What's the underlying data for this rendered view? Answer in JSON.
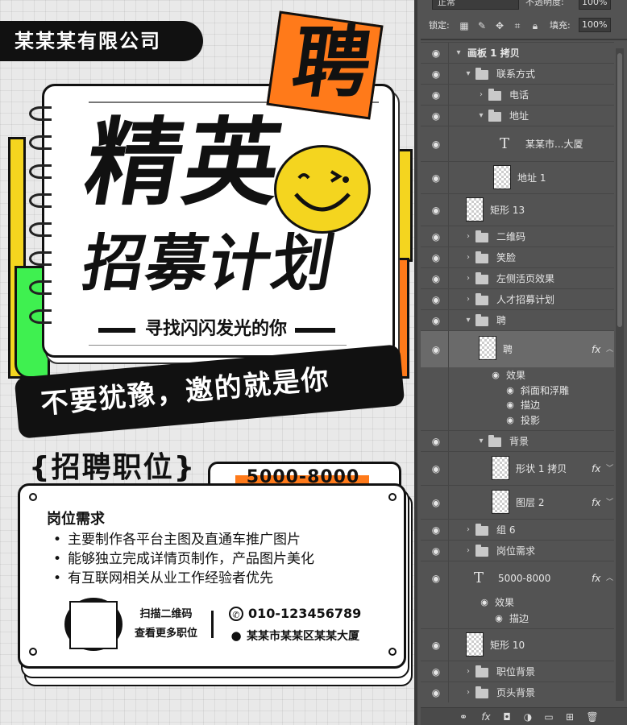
{
  "poster": {
    "company": "某某某有限公司",
    "badge_char": "聘",
    "headline_1": "精英",
    "headline_2": "招募计划",
    "tagline": "寻找闪闪发光的你",
    "slogan": "不要犹豫，邀的就是你",
    "jobs_title": "{招聘职位}",
    "salary": "5000-8000",
    "requirements_title": "岗位需求",
    "requirements": [
      "主要制作各平台主图及直通车推广图片",
      "能够独立完成详情页制作，产品图片美化",
      "有互联网相关从业工作经验者优先"
    ],
    "qr_line1": "扫描二维码",
    "qr_line2": "查看更多职位",
    "phone": "010-123456789",
    "address": "某某市某某区某某大厦",
    "colors": {
      "orange": "#ff7a1a",
      "yellow": "#f4d51f",
      "green": "#3ff050",
      "black": "#111111"
    }
  },
  "panel": {
    "blend_mode": "正常",
    "opacity_label": "不透明度:",
    "opacity_value": "100%",
    "lock_label": "锁定:",
    "fill_label": "填充:",
    "fill_value": "100%",
    "layers": [
      {
        "name": "画板 1 拷贝",
        "kind": "artboard"
      },
      {
        "name": "联系方式",
        "kind": "folder-open"
      },
      {
        "name": "电话",
        "kind": "folder"
      },
      {
        "name": "地址",
        "kind": "folder-open"
      },
      {
        "name": "某某市...大厦",
        "kind": "text"
      },
      {
        "name": "地址 1",
        "kind": "smart"
      },
      {
        "name": "矩形 13",
        "kind": "shape"
      },
      {
        "name": "二维码",
        "kind": "folder"
      },
      {
        "name": "笑脸",
        "kind": "folder"
      },
      {
        "name": "左侧活页效果",
        "kind": "folder"
      },
      {
        "name": "人才招募计划",
        "kind": "folder"
      },
      {
        "name": "聘",
        "kind": "folder-open"
      },
      {
        "name": "聘",
        "kind": "smart-fx"
      },
      {
        "name": "效果",
        "kind": "effects"
      },
      {
        "name": "斜面和浮雕",
        "kind": "effect"
      },
      {
        "name": "描边",
        "kind": "effect"
      },
      {
        "name": "投影",
        "kind": "effect"
      },
      {
        "name": "背景",
        "kind": "folder-open"
      },
      {
        "name": "形状 1 拷贝",
        "kind": "smart-fx"
      },
      {
        "name": "图层 2",
        "kind": "smart-fx"
      },
      {
        "name": "组 6",
        "kind": "folder"
      },
      {
        "name": "岗位需求",
        "kind": "folder"
      },
      {
        "name": "5000-8000",
        "kind": "text-fx"
      },
      {
        "name": "效果",
        "kind": "effects"
      },
      {
        "name": "描边",
        "kind": "effect"
      },
      {
        "name": "矩形 10",
        "kind": "shape"
      },
      {
        "name": "职位背景",
        "kind": "folder"
      },
      {
        "name": "页头背景",
        "kind": "folder"
      }
    ],
    "fx_label": "fx",
    "icons": {
      "eye": "eye-icon",
      "lock_transparent": "lock-transparent-icon",
      "lock_paint": "brush-icon",
      "lock_move": "move-icon",
      "lock_artboard": "artboard-icon",
      "lock_all": "lock-icon"
    }
  }
}
